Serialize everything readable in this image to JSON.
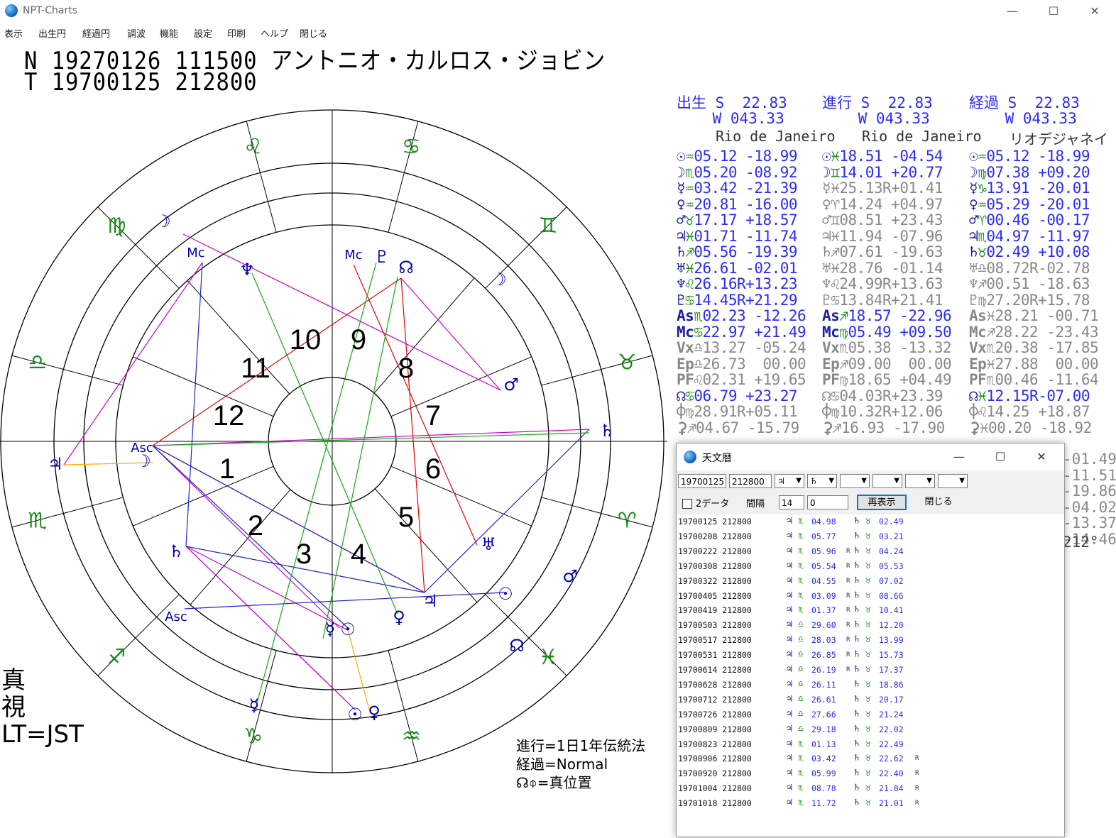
{
  "window": {
    "title": "NPT-Charts",
    "minimize": "—",
    "maximize": "☐",
    "close": "✕"
  },
  "menu": [
    "表示",
    "出生円",
    "経過円",
    "調波",
    "機能",
    "設定",
    "印刷",
    "ヘルプ",
    "閉じる"
  ],
  "header": {
    "line1": "N 19270126 111500 アントニオ・カルロス・ジョビン",
    "line2": "T 19700125 212800"
  },
  "side_note": {
    "line1": "真",
    "line2": "視",
    "line3": "LT=JST"
  },
  "footer_note": {
    "line1": "進行=1日1年伝統法",
    "line2": "経過=Normal",
    "line3": "☊⌽=真位置"
  },
  "houses": [
    "1",
    "2",
    "3",
    "4",
    "5",
    "6",
    "7",
    "8",
    "9",
    "10",
    "11",
    "12"
  ],
  "columns": [
    {
      "label": "出生",
      "lat": "S  22.83",
      "lon": "W 043.33",
      "city": "Rio de Janeiro"
    },
    {
      "label": "進行",
      "lat": "S  22.83",
      "lon": "W 043.33",
      "city": "Rio de Janeiro"
    },
    {
      "label": "経過",
      "lat": "S  22.83",
      "lon": "W 043.33",
      "city": "リオデジャネイ"
    }
  ],
  "planets": {
    "natal": [
      {
        "p": "☉",
        "s": "♒",
        "v": "05.12 -18.99"
      },
      {
        "p": "☽",
        "s": "♏",
        "v": "05.20 -08.92"
      },
      {
        "p": "☿",
        "s": "♒",
        "v": "03.42 -21.39"
      },
      {
        "p": "♀",
        "s": "♒",
        "v": "20.81 -16.00"
      },
      {
        "p": "♂",
        "s": "♉",
        "v": "17.17 +18.57"
      },
      {
        "p": "♃",
        "s": "♓",
        "v": "01.71 -11.74"
      },
      {
        "p": "♄",
        "s": "♐",
        "v": "05.56 -19.39"
      },
      {
        "p": "♅",
        "s": "♓",
        "v": "26.61 -02.01"
      },
      {
        "p": "♆",
        "s": "♌",
        "v": "26.16R+13.23"
      },
      {
        "p": "♇",
        "s": "♋",
        "v": "14.45R+21.29"
      },
      {
        "p": "As",
        "s": "♏",
        "v": "02.23 -12.26"
      },
      {
        "p": "Mc",
        "s": "♋",
        "v": "22.97 +21.49"
      },
      {
        "p": "Vx",
        "s": "♎",
        "v": "13.27 -05.24",
        "g": true
      },
      {
        "p": "Ep",
        "s": "♎",
        "v": "26.73  00.00",
        "g": true
      },
      {
        "p": "PF",
        "s": "♌",
        "v": "02.31 +19.65",
        "g": true
      },
      {
        "p": "☊",
        "s": "♋",
        "v": "06.79 +23.27"
      },
      {
        "p": "⌽",
        "s": "♍",
        "v": "28.91R+05.11",
        "g": true
      },
      {
        "p": "⚳",
        "s": "♐",
        "v": "04.67 -15.79",
        "g": true
      }
    ],
    "progressed": [
      {
        "p": "☉",
        "s": "♓",
        "v": "18.51 -04.54"
      },
      {
        "p": "☽",
        "s": "♊",
        "v": "14.01 +20.77"
      },
      {
        "p": "☿",
        "s": "♓",
        "v": "25.13R+01.41",
        "g": true
      },
      {
        "p": "♀",
        "s": "♈",
        "v": "14.24 +04.97",
        "g": true
      },
      {
        "p": "♂",
        "s": "♊",
        "v": "08.51 +23.43",
        "g": true
      },
      {
        "p": "♃",
        "s": "♓",
        "v": "11.94 -07.96",
        "g": true
      },
      {
        "p": "♄",
        "s": "♐",
        "v": "07.61 -19.63",
        "g": true
      },
      {
        "p": "♅",
        "s": "♓",
        "v": "28.76 -01.14",
        "g": true
      },
      {
        "p": "♆",
        "s": "♌",
        "v": "24.99R+13.63",
        "g": true
      },
      {
        "p": "♇",
        "s": "♋",
        "v": "13.84R+21.41",
        "g": true
      },
      {
        "p": "As",
        "s": "♐",
        "v": "18.57 -22.96"
      },
      {
        "p": "Mc",
        "s": "♍",
        "v": "05.49 +09.50"
      },
      {
        "p": "Vx",
        "s": "♏",
        "v": "05.38 -13.32",
        "g": true
      },
      {
        "p": "Ep",
        "s": "♐",
        "v": "09.00  00.00",
        "g": true
      },
      {
        "p": "PF",
        "s": "♍",
        "v": "18.65 +04.49",
        "g": true
      },
      {
        "p": "☊",
        "s": "♋",
        "v": "04.03R+23.39",
        "g": true
      },
      {
        "p": "⌽",
        "s": "♍",
        "v": "10.32R+12.06",
        "g": true
      },
      {
        "p": "⚳",
        "s": "♐",
        "v": "16.93 -17.90",
        "g": true
      }
    ],
    "transit": [
      {
        "p": "☉",
        "s": "♒",
        "v": "05.12 -18.99"
      },
      {
        "p": "☽",
        "s": "♍",
        "v": "07.38 +09.20"
      },
      {
        "p": "☿",
        "s": "♑",
        "v": "13.91 -20.01"
      },
      {
        "p": "♀",
        "s": "♒",
        "v": "05.29 -20.01"
      },
      {
        "p": "♂",
        "s": "♈",
        "v": "00.46 -00.17"
      },
      {
        "p": "♃",
        "s": "♏",
        "v": "04.97 -11.97"
      },
      {
        "p": "♄",
        "s": "♉",
        "v": "02.49 +10.08"
      },
      {
        "p": "♅",
        "s": "♎",
        "v": "08.72R-02.78",
        "g": true
      },
      {
        "p": "♆",
        "s": "♐",
        "v": "00.51 -18.63",
        "g": true
      },
      {
        "p": "♇",
        "s": "♍",
        "v": "27.20R+15.78",
        "g": true
      },
      {
        "p": "As",
        "s": "♓",
        "v": "28.21 -00.71",
        "g": true
      },
      {
        "p": "Mc",
        "s": "♐",
        "v": "28.22 -23.43",
        "g": true
      },
      {
        "p": "Vx",
        "s": "♏",
        "v": "20.38 -17.85",
        "g": true
      },
      {
        "p": "Ep",
        "s": "♓",
        "v": "27.88  00.00",
        "g": true
      },
      {
        "p": "PF",
        "s": "♏",
        "v": "00.46 -11.64",
        "g": true
      },
      {
        "p": "☊",
        "s": "♓",
        "v": "12.15R-07.00"
      },
      {
        "p": "⌽",
        "s": "♌",
        "v": "14.25 +18.87",
        "g": true
      },
      {
        "p": "⚳",
        "s": "♓",
        "v": "00.20 -18.92",
        "g": true
      }
    ]
  },
  "overflow_values": [
    "-01.49",
    "-11.51",
    "-19.86",
    "-04.02",
    "-13.37",
    "-14.46"
  ],
  "degree_note": "212°",
  "dialog": {
    "title": "天文暦",
    "date": "19700125",
    "time": "212800",
    "planet1": "♃",
    "planet2": "♄",
    "two_data_label": "2データ",
    "interval_label": "間隔",
    "interval": "14",
    "offset": "0",
    "redisplay_button": "再表示",
    "close_button": "閉じる",
    "rows": [
      {
        "d": "19700125 212800",
        "js": "♏",
        "jv": "04.98",
        "jr": "",
        "ss": "♉",
        "sv": "02.49",
        "sr": ""
      },
      {
        "d": "19700208 212800",
        "js": "♏",
        "jv": "05.77",
        "jr": "",
        "ss": "♉",
        "sv": "03.21",
        "sr": ""
      },
      {
        "d": "19700222 212800",
        "js": "♏",
        "jv": "05.96",
        "jr": "R",
        "ss": "♉",
        "sv": "04.24",
        "sr": ""
      },
      {
        "d": "19700308 212800",
        "js": "♏",
        "jv": "05.54",
        "jr": "R",
        "ss": "♉",
        "sv": "05.53",
        "sr": ""
      },
      {
        "d": "19700322 212800",
        "js": "♏",
        "jv": "04.55",
        "jr": "R",
        "ss": "♉",
        "sv": "07.02",
        "sr": ""
      },
      {
        "d": "19700405 212800",
        "js": "♏",
        "jv": "03.09",
        "jr": "R",
        "ss": "♉",
        "sv": "08.66",
        "sr": ""
      },
      {
        "d": "19700419 212800",
        "js": "♏",
        "jv": "01.37",
        "jr": "R",
        "ss": "♉",
        "sv": "10.41",
        "sr": ""
      },
      {
        "d": "19700503 212800",
        "js": "♎",
        "jv": "29.60",
        "jr": "R",
        "ss": "♉",
        "sv": "12.20",
        "sr": ""
      },
      {
        "d": "19700517 212800",
        "js": "♎",
        "jv": "28.03",
        "jr": "R",
        "ss": "♉",
        "sv": "13.99",
        "sr": ""
      },
      {
        "d": "19700531 212800",
        "js": "♎",
        "jv": "26.85",
        "jr": "R",
        "ss": "♉",
        "sv": "15.73",
        "sr": ""
      },
      {
        "d": "19700614 212800",
        "js": "♎",
        "jv": "26.19",
        "jr": "R",
        "ss": "♉",
        "sv": "17.37",
        "sr": ""
      },
      {
        "d": "19700628 212800",
        "js": "♎",
        "jv": "26.11",
        "jr": "",
        "ss": "♉",
        "sv": "18.86",
        "sr": ""
      },
      {
        "d": "19700712 212800",
        "js": "♎",
        "jv": "26.61",
        "jr": "",
        "ss": "♉",
        "sv": "20.17",
        "sr": ""
      },
      {
        "d": "19700726 212800",
        "js": "♎",
        "jv": "27.66",
        "jr": "",
        "ss": "♉",
        "sv": "21.24",
        "sr": ""
      },
      {
        "d": "19700809 212800",
        "js": "♎",
        "jv": "29.18",
        "jr": "",
        "ss": "♉",
        "sv": "22.02",
        "sr": ""
      },
      {
        "d": "19700823 212800",
        "js": "♏",
        "jv": "01.13",
        "jr": "",
        "ss": "♉",
        "sv": "22.49",
        "sr": ""
      },
      {
        "d": "19700906 212800",
        "js": "♏",
        "jv": "03.42",
        "jr": "",
        "ss": "♉",
        "sv": "22.62",
        "sr": "R"
      },
      {
        "d": "19700920 212800",
        "js": "♏",
        "jv": "05.99",
        "jr": "",
        "ss": "♉",
        "sv": "22.40",
        "sr": "R"
      },
      {
        "d": "19701004 212800",
        "js": "♏",
        "jv": "08.78",
        "jr": "",
        "ss": "♉",
        "sv": "21.84",
        "sr": "R"
      },
      {
        "d": "19701018 212800",
        "js": "♏",
        "jv": "11.72",
        "jr": "",
        "ss": "♉",
        "sv": "21.01",
        "sr": "R"
      }
    ]
  }
}
